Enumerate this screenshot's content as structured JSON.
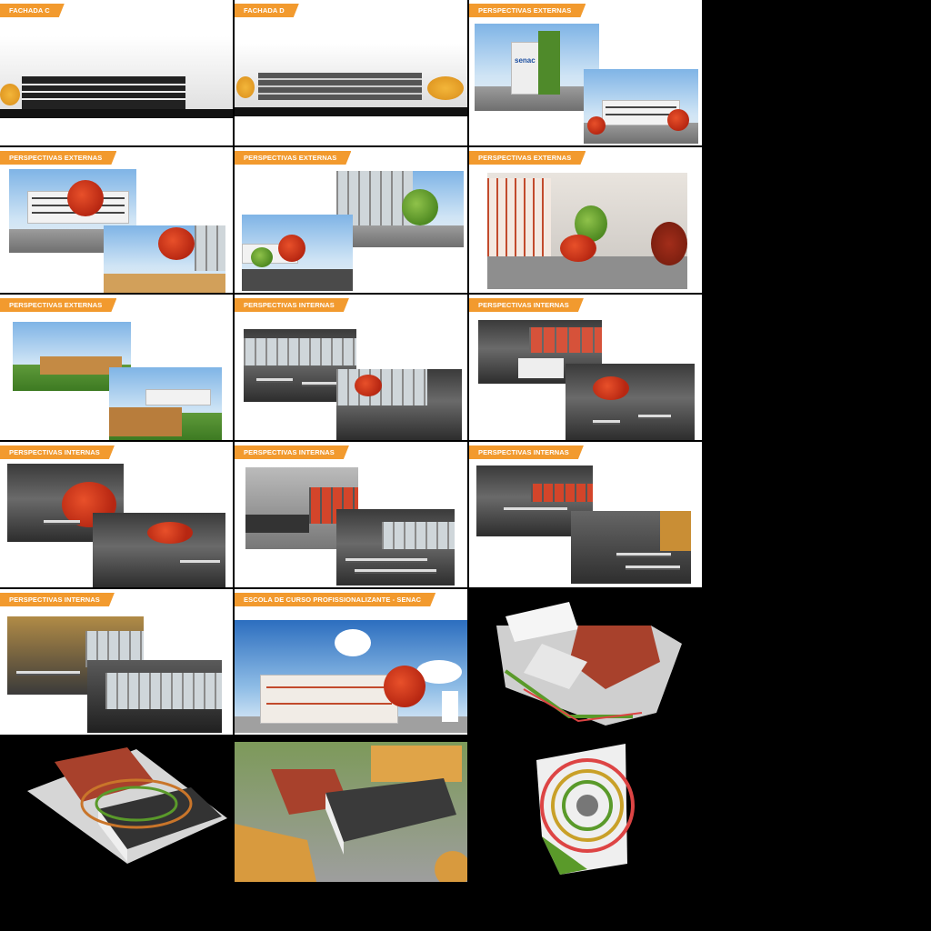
{
  "labels": {
    "fachada_c": "FACHADA C",
    "fachada_d": "FACHADA D",
    "ext1": "PERSPECTIVAS EXTERNAS",
    "ext2": "PERSPECTIVAS EXTERNAS",
    "ext3": "PERSPECTIVAS EXTERNAS",
    "ext4": "PERSPECTIVAS EXTERNAS",
    "ext5": "PERSPECTIVAS EXTERNAS",
    "int1": "PERSPECTIVAS INTERNAS",
    "int2": "PERSPECTIVAS INTERNAS",
    "int3": "PERSPECTIVAS INTERNAS",
    "int4": "PERSPECTIVAS INTERNAS",
    "int5": "PERSPECTIVAS INTERNAS",
    "int6": "PERSPECTIVAS INTERNAS",
    "senac": "ESCOLA DE CURSO PROFISSIONALIZANTE - SENAC"
  },
  "sign_text": "senac",
  "colors": {
    "label_bg": "#f29a2e",
    "roof_red": "#a8412c",
    "tree_red": "#d2371c",
    "grass": "#4f8a22",
    "background": "#000000"
  }
}
